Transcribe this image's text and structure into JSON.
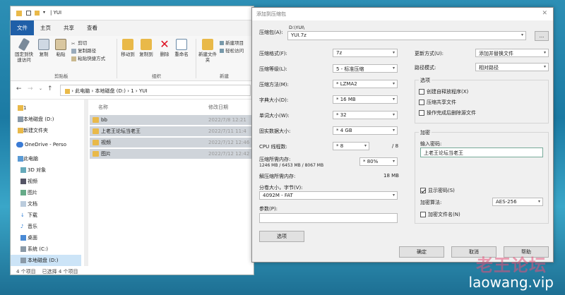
{
  "explorer": {
    "title_path": "| YUI",
    "menu": [
      "文件",
      "主页",
      "共享",
      "查看"
    ],
    "ribbon": {
      "pin_label": "固定到快速访问",
      "copy_label": "复制",
      "paste_label": "粘贴",
      "cut_label": "剪切",
      "copy_path_label": "复制路径",
      "paste_shortcut_label": "粘贴快捷方式",
      "clipboard_group": "剪贴板",
      "move_to_label": "移动到",
      "copy_to_label": "复制到",
      "delete_label": "删除",
      "rename_label": "重命名",
      "organize_group": "组织",
      "new_folder_label": "新建文件夹",
      "new_item_label": "新建项目",
      "easy_access_label": "轻松访问",
      "new_group": "新建"
    },
    "address": [
      "此电脑",
      "本地磁盘 (D:)",
      "1",
      "YUI"
    ],
    "nav": [
      {
        "label": "1",
        "icon": "folder-icon"
      },
      {
        "label": "本地磁盘 (D:)",
        "icon": "drive-icon"
      },
      {
        "label": "新建文件夹",
        "icon": "folder-icon"
      },
      {
        "label": "OneDrive - Perso",
        "icon": "cloud-icon"
      },
      {
        "label": "此电脑",
        "icon": "pc-icon"
      },
      {
        "label": "3D 对象",
        "icon": "cube-icon"
      },
      {
        "label": "视频",
        "icon": "video-icon"
      },
      {
        "label": "图片",
        "icon": "picture-icon"
      },
      {
        "label": "文档",
        "icon": "document-icon"
      },
      {
        "label": "下载",
        "icon": "download-icon"
      },
      {
        "label": "音乐",
        "icon": "music-icon"
      },
      {
        "label": "桌面",
        "icon": "desktop-icon"
      },
      {
        "label": "系统 (C:)",
        "icon": "drive-icon"
      },
      {
        "label": "本地磁盘 (D:)",
        "icon": "drive-icon"
      }
    ],
    "columns": {
      "name": "名称",
      "date": "修改日期"
    },
    "files": [
      {
        "name": "bb",
        "date": "2022/7/8 12:21"
      },
      {
        "name": "上老王论坛当老王",
        "date": "2022/7/11 11:4"
      },
      {
        "name": "视频",
        "date": "2022/7/12 12:46"
      },
      {
        "name": "图片",
        "date": "2022/7/12 12:42"
      }
    ],
    "status": {
      "count": "4 个项目",
      "selected": "已选择 4 个项目"
    }
  },
  "dialog": {
    "title": "添加到压缩包",
    "archive_label": "压缩包(A):",
    "archive_path": "D:\\YUI\\",
    "archive_name": "YUI.7z",
    "browse_label": "...",
    "format_label": "压缩格式(F):",
    "format_value": "7z",
    "level_label": "压缩等级(L):",
    "level_value": "5 - 标准压缩",
    "method_label": "压缩方法(M):",
    "method_value": "* LZMA2",
    "dict_label": "字典大小(D):",
    "dict_value": "* 16 MB",
    "word_label": "单词大小(W):",
    "word_value": "* 32",
    "solid_label": "固实数据大小:",
    "solid_value": "* 4 GB",
    "threads_label": "CPU 线程数:",
    "threads_value": "* 8",
    "threads_max": "/ 8",
    "mem_label": "压缩所需内存:",
    "mem_value": "1246 MB / 6453 MB / 8067 MB",
    "mem_pct": "* 80%",
    "decomp_label": "解压缩所需内存:",
    "decomp_value": "18 MB",
    "split_label": "分卷大小，字节(V):",
    "split_value": "4092M - FAT",
    "params_label": "参数(P):",
    "options_btn": "选项",
    "update_label": "更新方式(U):",
    "update_value": "添加并替换文件",
    "pathmode_label": "路径模式:",
    "pathmode_value": "相对路径",
    "options_group": "选项",
    "opt_sfx": "创建自释放程序(X)",
    "opt_shared": "压缩共享文件",
    "opt_delete": "操作完成后删除源文件",
    "enc_group": "加密",
    "pwd_label": "输入密码:",
    "pwd_value": "上老王论坛当老王",
    "show_pwd": "显示密码(S)",
    "enc_method_label": "加密算法:",
    "enc_method_value": "AES-256",
    "enc_names": "加密文件名(N)",
    "ok": "确定",
    "cancel": "取消",
    "help": "帮助"
  },
  "watermark": {
    "cn": "老王论坛",
    "url": "laowang.vip"
  }
}
